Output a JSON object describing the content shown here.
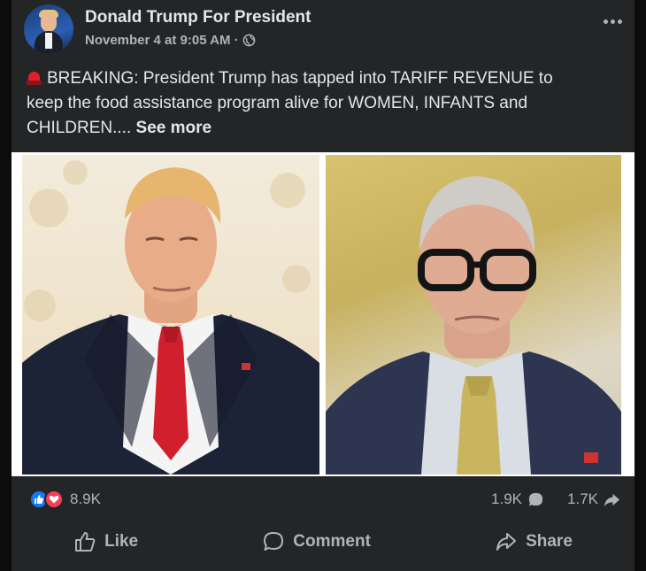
{
  "post": {
    "author": "Donald Trump For President",
    "timestamp": "November 4 at 9:05 AM",
    "separator": "·",
    "text_line1": "BREAKING: President Trump has tapped into TARIFF REVENUE to",
    "text_line2": "keep the food assistance program alive for WOMEN, INFANTS and",
    "text_line3": "CHILDREN....",
    "see_more": "See more"
  },
  "reactions": {
    "count": "8.9K",
    "comments": "1.9K",
    "shares": "1.7K"
  },
  "actions": {
    "like": "Like",
    "comment": "Comment",
    "share": "Share"
  },
  "icons": {
    "siren": "police-light-icon",
    "privacy": "globe-icon",
    "menu": "more-options-icon"
  },
  "colors": {
    "card_bg": "#242526",
    "text_primary": "#e4e6eb",
    "text_secondary": "#b0b3b8",
    "like_blue": "#1877f2",
    "love_red": "#f33e58",
    "tie_red": "#d0202e"
  }
}
